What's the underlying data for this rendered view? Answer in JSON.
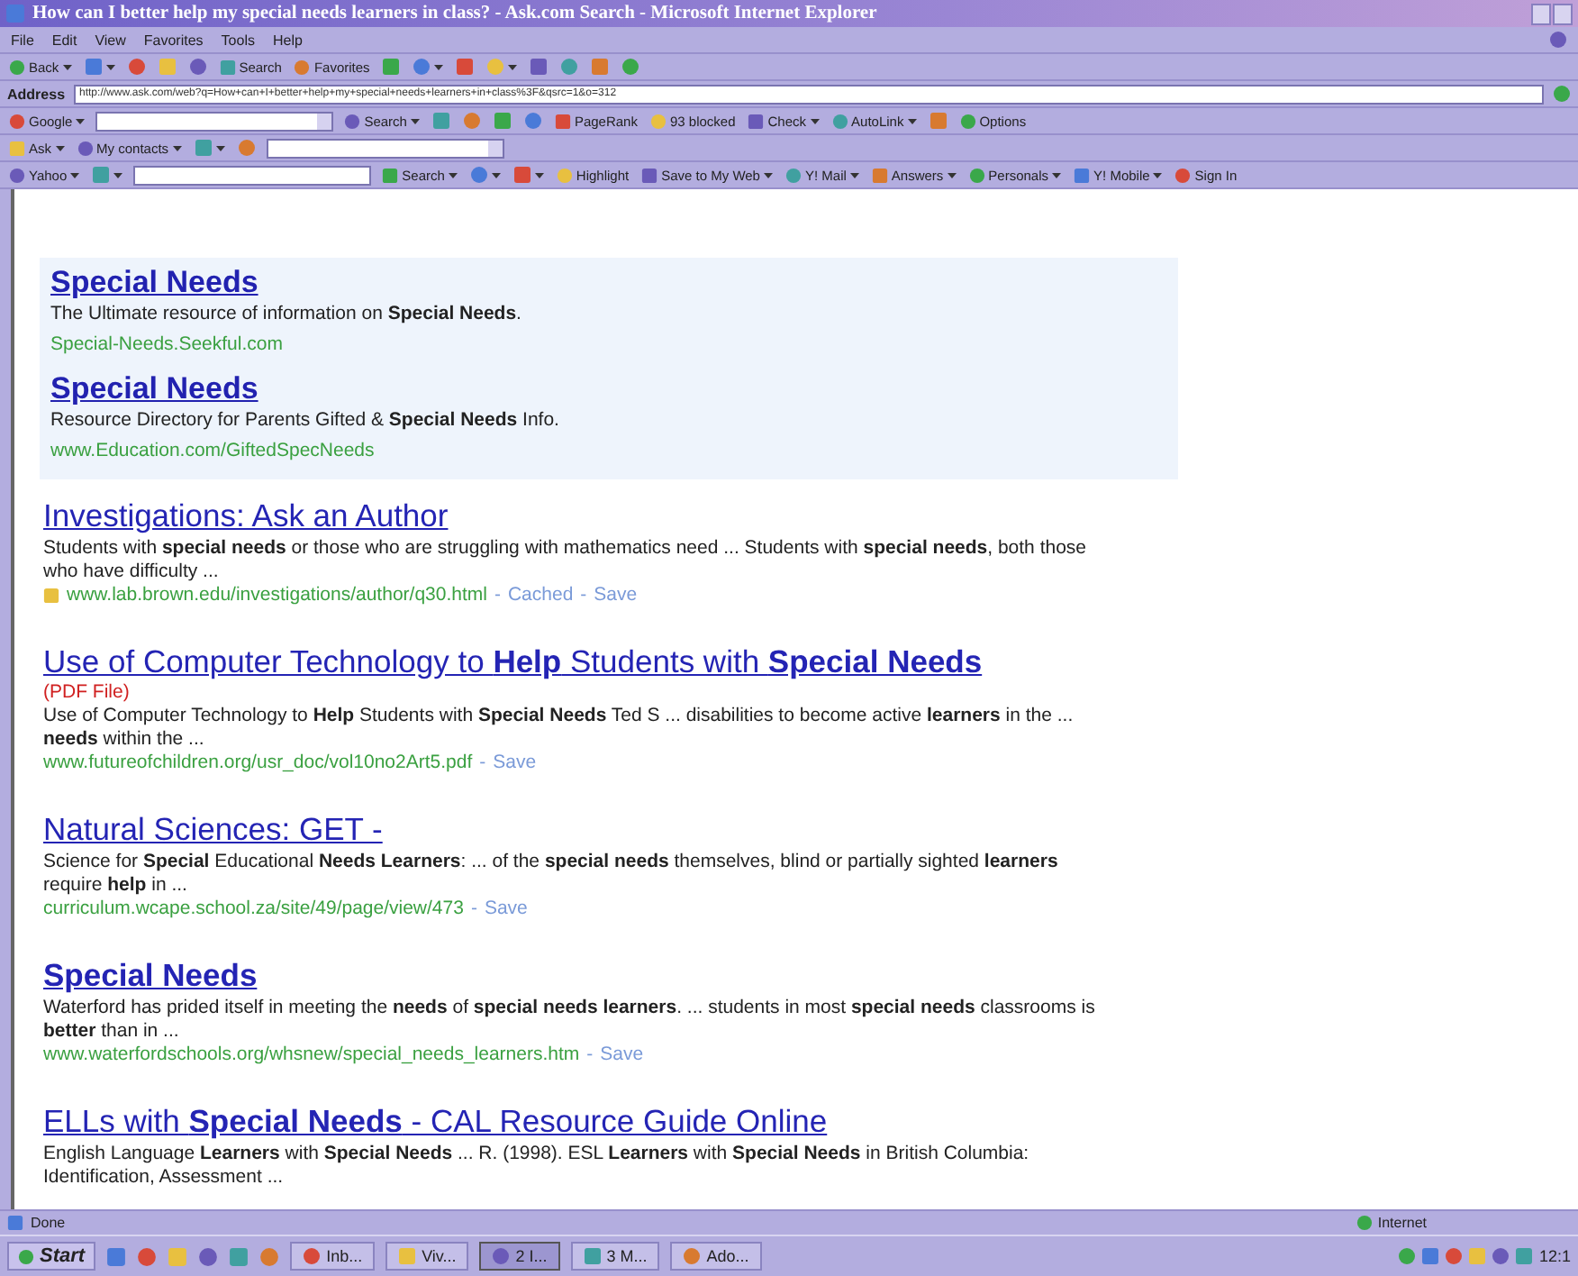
{
  "window": {
    "title": "How can I better help my special needs learners in class? - Ask.com Search - Microsoft Internet Explorer"
  },
  "menu": [
    "File",
    "Edit",
    "View",
    "Favorites",
    "Tools",
    "Help"
  ],
  "toolbars": [
    {
      "kind": "buttons",
      "items": [
        {
          "kind": "button",
          "label": "Back",
          "dropdown": true
        },
        {
          "kind": "icon",
          "dropdown": true
        },
        {
          "kind": "icon",
          "dropdown": false
        },
        {
          "kind": "icon",
          "dropdown": false
        },
        {
          "kind": "icon",
          "dropdown": false
        },
        {
          "kind": "button",
          "label": "Search",
          "dropdown": false
        },
        {
          "kind": "button",
          "label": "Favorites",
          "dropdown": false
        },
        {
          "kind": "icon",
          "dropdown": false
        },
        {
          "kind": "icon",
          "dropdown": true
        },
        {
          "kind": "icon",
          "dropdown": false
        },
        {
          "kind": "icon",
          "dropdown": true
        },
        {
          "kind": "icon",
          "dropdown": false
        },
        {
          "kind": "icon",
          "dropdown": false
        },
        {
          "kind": "icon",
          "dropdown": false
        },
        {
          "kind": "icon",
          "dropdown": false
        }
      ]
    },
    {
      "kind": "address",
      "label": "Address",
      "value": "http://www.ask.com/web?q=How+can+I+better+help+my+special+needs+learners+in+class%3F&qsrc=1&o=312"
    },
    {
      "kind": "buttons",
      "items": [
        {
          "kind": "button",
          "label": "Google",
          "dropdown": true
        },
        {
          "kind": "field",
          "dropdown": true
        },
        {
          "kind": "button",
          "label": "Search",
          "dropdown": true
        },
        {
          "kind": "icon",
          "dropdown": false
        },
        {
          "kind": "icon",
          "dropdown": false
        },
        {
          "kind": "icon",
          "dropdown": false
        },
        {
          "kind": "icon",
          "dropdown": false
        },
        {
          "kind": "button",
          "label": "PageRank",
          "dropdown": false
        },
        {
          "kind": "button",
          "label": "93 blocked",
          "dropdown": false
        },
        {
          "kind": "button",
          "label": "Check",
          "dropdown": true
        },
        {
          "kind": "button",
          "label": "AutoLink",
          "dropdown": true
        },
        {
          "kind": "icon",
          "dropdown": false
        },
        {
          "kind": "button",
          "label": "Options",
          "dropdown": false
        }
      ]
    },
    {
      "kind": "buttons",
      "items": [
        {
          "kind": "button",
          "label": "Ask",
          "dropdown": true
        },
        {
          "kind": "button",
          "label": "My contacts",
          "dropdown": true
        },
        {
          "kind": "icon",
          "dropdown": true
        },
        {
          "kind": "icon",
          "dropdown": false
        },
        {
          "kind": "field",
          "dropdown": true
        }
      ]
    },
    {
      "kind": "buttons",
      "items": [
        {
          "kind": "button",
          "label": "Yahoo",
          "dropdown": true
        },
        {
          "kind": "icon",
          "dropdown": true
        },
        {
          "kind": "field",
          "dropdown": false
        },
        {
          "kind": "button",
          "label": "Search",
          "dropdown": true
        },
        {
          "kind": "icon",
          "dropdown": true
        },
        {
          "kind": "icon",
          "dropdown": true
        },
        {
          "kind": "button",
          "label": "Highlight",
          "dropdown": false
        },
        {
          "kind": "button",
          "label": "Save to My Web",
          "dropdown": true
        },
        {
          "kind": "button",
          "label": "Y! Mail",
          "dropdown": true
        },
        {
          "kind": "button",
          "label": "Answers",
          "dropdown": true
        },
        {
          "kind": "button",
          "label": "Personals",
          "dropdown": true
        },
        {
          "kind": "button",
          "label": "Y! Mobile",
          "dropdown": true
        },
        {
          "kind": "button",
          "label": "Sign In",
          "dropdown": false
        }
      ]
    }
  ],
  "sponsored": [
    {
      "title": "Special Needs",
      "snippet": "The Ultimate resource of information on **Special Needs**.",
      "url": "Special-Needs.Seekful.com"
    },
    {
      "title": "Special Needs",
      "snippet": "Resource Directory for Parents Gifted & **Special Needs** Info.",
      "url": "www.Education.com/GiftedSpecNeeds"
    }
  ],
  "results": [
    {
      "title": "Investigations: Ask an Author",
      "title_bold": false,
      "snippet": "Students with **special needs** or those who are struggling with mathematics need ... Students with **special needs**, both those who have difficulty ...",
      "url_icon": true,
      "url": "www.lab.brown.edu/investigations/author/q30.html",
      "links": [
        {
          "separator": "-",
          "label": "Cached"
        },
        {
          "separator": "-",
          "label": "Save"
        }
      ]
    },
    {
      "title": "Use of Computer Technology to **Help** Students with **Special Needs**",
      "title_bold": false,
      "file_type": "(PDF File)",
      "snippet": "Use of Computer Technology to **Help** Students with **Special Needs** Ted S ... disabilities to become active **learners** in the ... **needs** within the ...",
      "url_icon": false,
      "url": "www.futureofchildren.org/usr_doc/vol10no2Art5.pdf",
      "links": [
        {
          "separator": "-",
          "label": "Save"
        }
      ]
    },
    {
      "title": "Natural Sciences: GET -",
      "title_bold": false,
      "snippet": "Science for **Special** Educational **Needs Learners**: ... of the **special needs** themselves, blind or partially sighted **learners** require **help** in ...",
      "url_icon": false,
      "url": "curriculum.wcape.school.za/site/49/page/view/473",
      "links": [
        {
          "separator": "-",
          "label": "Save"
        }
      ]
    },
    {
      "title": "Special Needs",
      "title_bold": true,
      "snippet": "Waterford has prided itself in meeting the **needs** of **special needs learners**. ... students in most **special needs** classrooms is **better** than in ...",
      "url_icon": false,
      "url": "www.waterfordschools.org/whsnew/special_needs_learners.htm",
      "links": [
        {
          "separator": "-",
          "label": "Save"
        }
      ]
    },
    {
      "title": "ELLs with **Special Needs** - CAL Resource Guide Online",
      "title_bold": false,
      "snippet": "English Language **Learners** with **Special Needs** ... R. (1998). ESL **Learners** with **Special Needs** in British Columbia: Identification, Assessment ..."
    }
  ],
  "status_bar": {
    "text": "Done",
    "zone": "Internet"
  },
  "taskbar": {
    "start": "Start",
    "tasks": [
      {
        "label": "Inb...",
        "selected": false
      },
      {
        "label": "Viv...",
        "selected": false
      },
      {
        "label": "2 I...",
        "selected": true
      },
      {
        "label": "3 M...",
        "selected": false
      },
      {
        "label": "Ado...",
        "selected": false
      }
    ],
    "clock": "12:1"
  }
}
